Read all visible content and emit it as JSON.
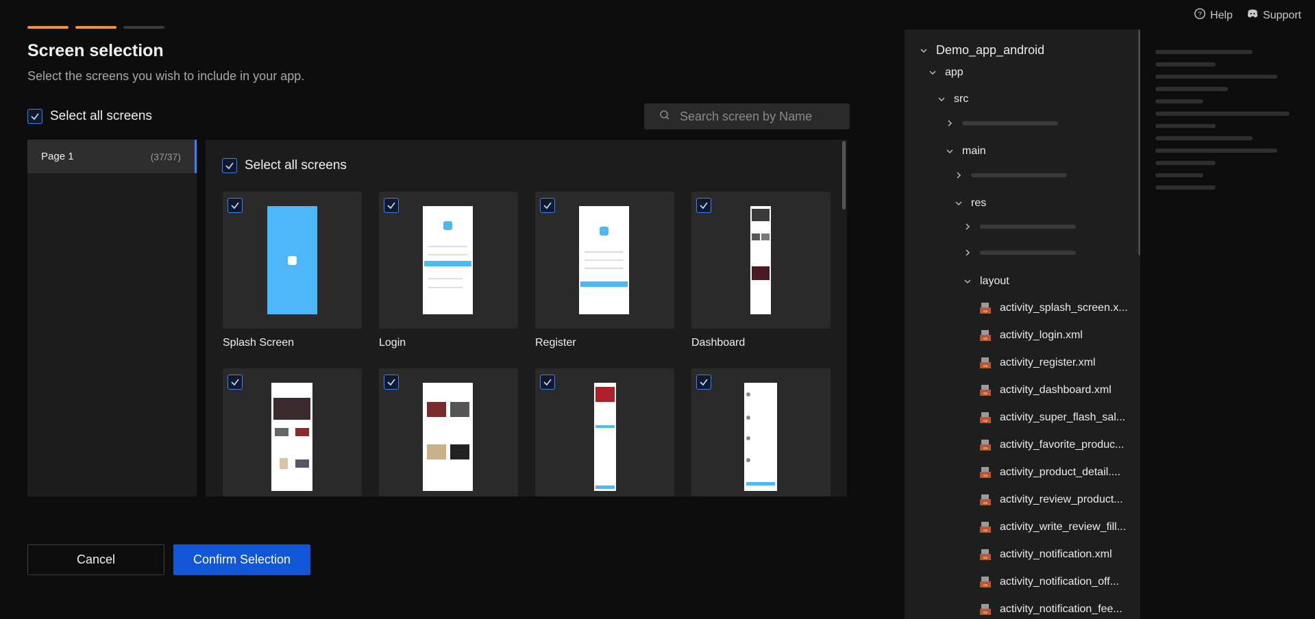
{
  "top_links": {
    "help": "Help",
    "support": "Support"
  },
  "header": {
    "title": "Screen selection",
    "subtitle": "Select the screens you wish to include in your app.",
    "select_all_label": "Select all screens",
    "progress_steps": [
      {
        "state": "complete",
        "color": "#f0903a"
      },
      {
        "state": "complete",
        "color": "#f0903a"
      },
      {
        "state": "pending",
        "color": "#3a3a3a"
      }
    ]
  },
  "search": {
    "placeholder": "Search screen by Name"
  },
  "pages": [
    {
      "label": "Page 1",
      "count": "(37/37)"
    }
  ],
  "grid": {
    "select_all_label": "Select all screens",
    "screens": [
      {
        "label": "Splash Screen",
        "checked": true
      },
      {
        "label": "Login",
        "checked": true
      },
      {
        "label": "Register",
        "checked": true
      },
      {
        "label": "Dashboard",
        "checked": true
      },
      {
        "label": "",
        "checked": true
      },
      {
        "label": "",
        "checked": true
      },
      {
        "label": "",
        "checked": true
      },
      {
        "label": "",
        "checked": true
      }
    ]
  },
  "buttons": {
    "cancel": "Cancel",
    "confirm": "Confirm Selection"
  },
  "tree": {
    "root": "Demo_app_android",
    "app": "app",
    "src": "src",
    "main": "main",
    "res": "res",
    "layout": "layout",
    "files": [
      "activity_splash_screen.x...",
      "activity_login.xml",
      "activity_register.xml",
      "activity_dashboard.xml",
      "activity_super_flash_sal...",
      "activity_favorite_produc...",
      "activity_product_detail....",
      "activity_review_product...",
      "activity_write_review_fill...",
      "activity_notification.xml",
      "activity_notification_off...",
      "activity_notification_fee..."
    ]
  },
  "colors": {
    "accent": "#f0903a",
    "primary": "#1156d6",
    "check": "#3b82f6",
    "splash": "#4cb8fa"
  }
}
